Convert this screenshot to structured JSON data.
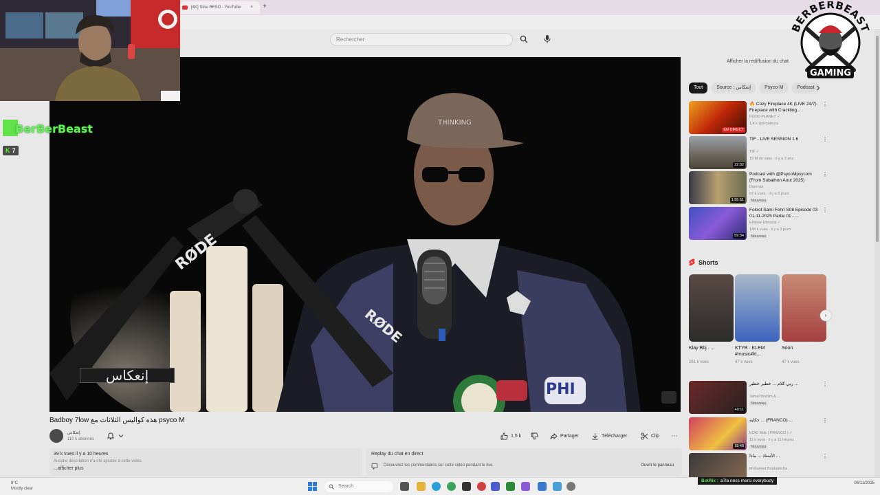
{
  "browser": {
    "tab_title": "[4K] Stou RESO - YouTube",
    "tab_close": "×",
    "new_tab": "+"
  },
  "youtube": {
    "search_placeholder": "Rechercher",
    "video": {
      "title": "Badboy 7low هذه كواليس الثلاثاث مع psyco M",
      "overlay_logo": "إنعكاس",
      "channel_name": "إنعكاس",
      "channel_subs": "110 k abonnés",
      "likes": "1,5 k",
      "actions": {
        "share": "Partager",
        "download": "Télécharger",
        "clip": "Clip",
        "more": "⋯"
      }
    },
    "description": {
      "views_time": "39 k vues  il y a 10 heures",
      "empty_text": "Aucune description n'a été ajoutée à cette vidéo.",
      "show_more": "...afficher plus"
    },
    "replay": {
      "title": "Replay du chat en direct",
      "text": "Découvrez les commentaires sur cette vidéo pendant le live.",
      "open": "Ouvrir le panneau"
    },
    "sidebar": {
      "chat_replay_btn": "Afficher la rediffusion du chat",
      "chips": [
        "Tout",
        "Source : إنعكاس",
        "Psyco-M",
        "Podcast"
      ],
      "recommendations": [
        {
          "title": "🔥 Cozy Fireplace 4K (LIVE 24/7). Fireplace with Crackling...",
          "channel": "FOOD PLANET ✓",
          "meta": "1,4 k spectateurs",
          "badge": "",
          "duration": "EN DIRECT"
        },
        {
          "title": "TIF - LIVE SESSION 1.6",
          "channel": "TIF ✓",
          "meta": "10 M de vues · il y a 3 ans",
          "badge": "",
          "duration": "22:32"
        },
        {
          "title": "Podcast with @PsycoMpsycom (From Subathon Aout 2025)",
          "channel": "Danmax",
          "meta": "57 k vues · il y a 3 jours",
          "badge": "Nouveau",
          "duration": "1:55:51"
        },
        {
          "title": "Fokrot Sami Fehri S08 Episode 03 01-11-2025 Partie 01 - ...",
          "channel": "Elhiwar Ettounsi ✓",
          "meta": "148 k vues · il y a 3 jours",
          "badge": "Nouveau",
          "duration": "59:34"
        }
      ],
      "shorts_label": "Shorts",
      "shorts": [
        {
          "title": "Klay Bbj · ...",
          "meta": "261 k vues"
        },
        {
          "title": "KTYB · KLEM #music#kt...",
          "meta": "47 k vues"
        },
        {
          "title": "Soon",
          "meta": "47 k vues"
        }
      ],
      "more_recs": [
        {
          "title": "ربي كلام ... خطير خطير ...",
          "channel": "Jamal Brahim & ...",
          "meta": "",
          "badge": "Nouveau",
          "duration": "40:11"
        },
        {
          "title": "حكاية ... (FRANCO) ...",
          "channel": "KOKI Mok ( FRANCO ) ✓",
          "meta": "11 k vues · il y a 11 heures",
          "badge": "Nouveau",
          "duration": "18:48"
        },
        {
          "title": "الأستاذ ... ماذا ...",
          "channel": "Mohamed Boukamcha",
          "meta": "",
          "badge": "",
          "duration": ""
        }
      ]
    }
  },
  "overlay": {
    "streamer_name": "BerBerBeast",
    "kick_k": "K",
    "kick_count": "7",
    "brand_top": "BERBERBEAST",
    "brand_bottom": "GAMING",
    "notification_bot": "BotRix :",
    "notification_text": "a7la ness merci everybody"
  },
  "taskbar": {
    "weather_temp": "8°C",
    "weather_desc": "Mostly clear",
    "search": "Search",
    "clock_date": "06/11/2025"
  },
  "colors": {
    "youtube_red": "#ff0000",
    "kick_green": "#53fc18",
    "streamer_green": "#64f05a"
  }
}
